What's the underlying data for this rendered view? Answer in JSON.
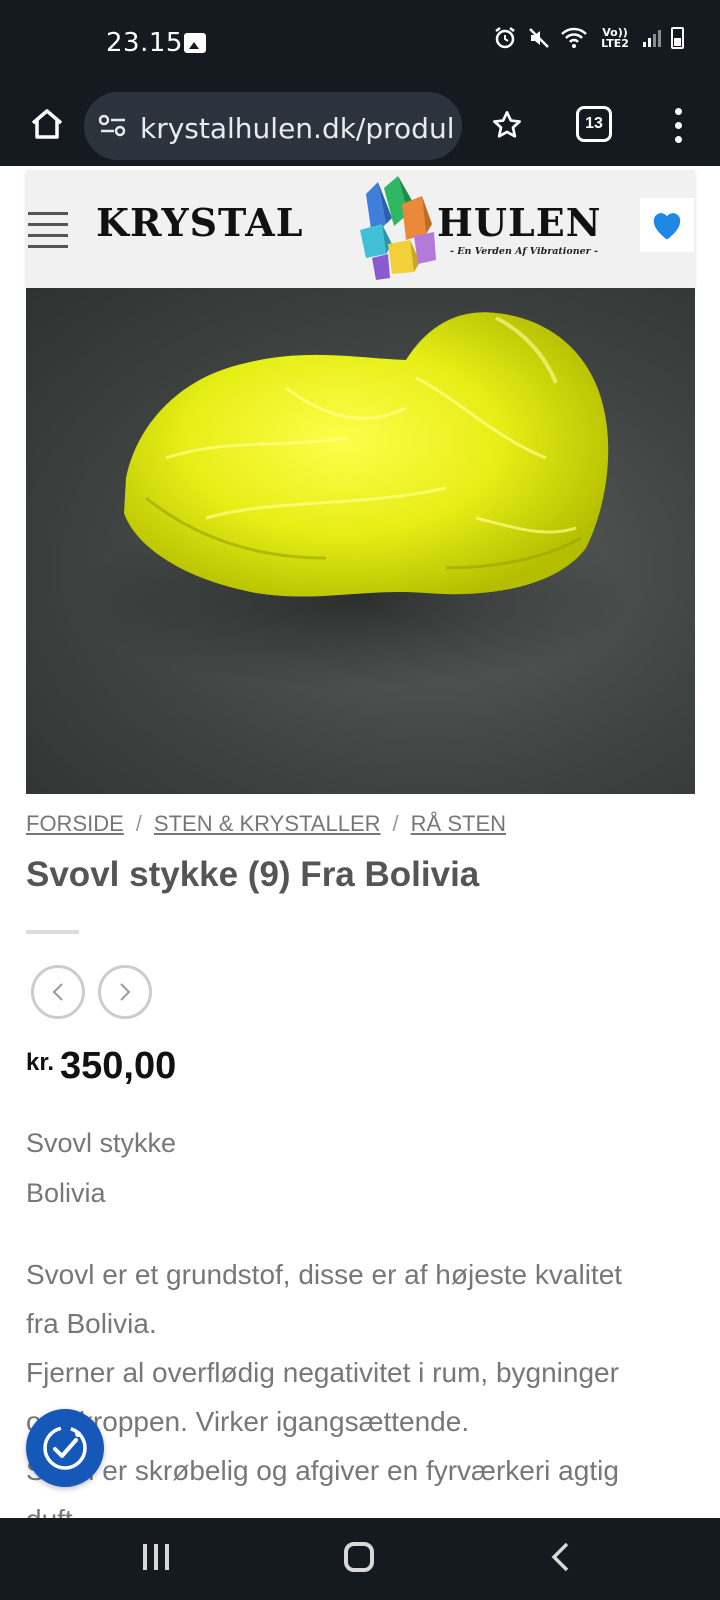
{
  "status_bar": {
    "time": "23.15",
    "network_label": "Vo)) LTE2"
  },
  "browser": {
    "url": "krystalhulen.dk/produl",
    "tab_count": "13"
  },
  "site": {
    "logo_left": "KRYSTAL",
    "logo_right": "HULEN",
    "logo_tagline": "- En Verden Af Vibrationer -",
    "accent_color": "#1e88e5"
  },
  "breadcrumb": {
    "items": [
      "FORSIDE",
      "STEN & KRYSTALLER",
      "RÅ STEN"
    ],
    "separator": "/"
  },
  "product": {
    "title": "Svovl stykke (9) Fra Bolivia",
    "price_currency": "kr.",
    "price_value": "350,00",
    "short_desc": [
      "Svovl stykke",
      "Bolivia"
    ],
    "description": [
      "Svovl er et grundstof, disse er af højeste kvalitet",
      "fra Bolivia.",
      "Fjerner al overflødig negativitet i rum, bygninger",
      "og i kroppen. Virker igangsættende.",
      "Svovl er skrøbelig og afgiver en fyrværkeri agtig",
      "duft."
    ]
  }
}
